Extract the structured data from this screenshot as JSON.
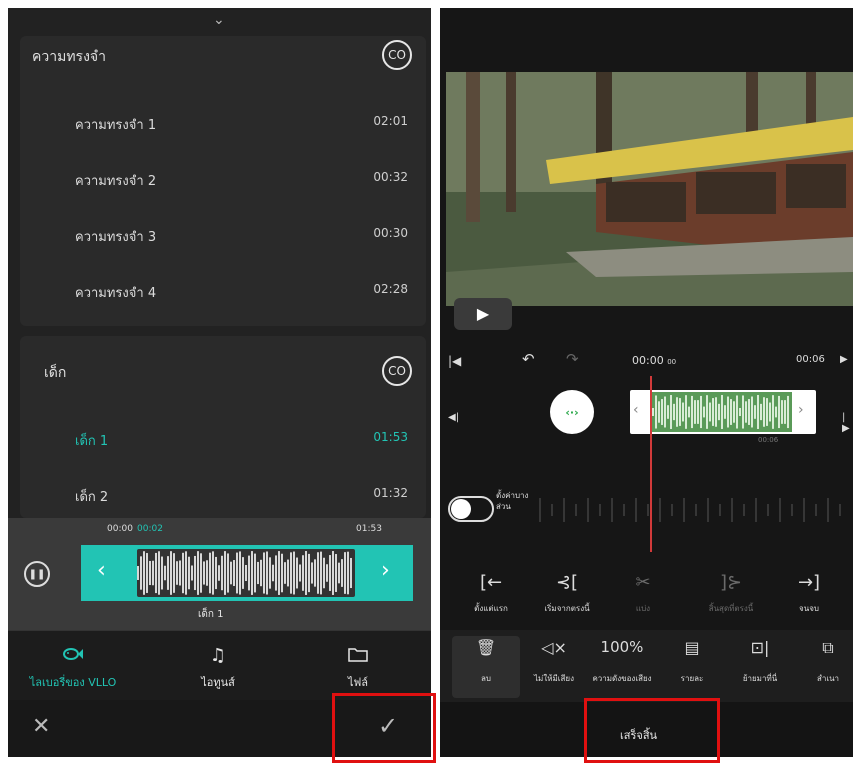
{
  "left": {
    "groups": [
      {
        "title": "ความทรงจำ",
        "badge": "CO",
        "tracks": [
          {
            "name": "ความทรงจำ 1",
            "duration": "02:01"
          },
          {
            "name": "ความทรงจำ 2",
            "duration": "00:32"
          },
          {
            "name": "ความทรงจำ 3",
            "duration": "00:30"
          },
          {
            "name": "ความทรงจำ 4",
            "duration": "02:28"
          }
        ]
      },
      {
        "title": "เด็ก",
        "badge": "CO",
        "tracks": [
          {
            "name": "เด็ก 1",
            "duration": "01:53",
            "selected": true
          },
          {
            "name": "เด็ก 2",
            "duration": "01:32"
          }
        ]
      }
    ],
    "player": {
      "time_start": "00:00",
      "time_current": "00:02",
      "time_end": "01:53",
      "track_name": "เด็ก 1"
    },
    "nav": [
      {
        "label": "ไลเบอรี่ของ VLLO",
        "icon": "fish-icon",
        "active": true
      },
      {
        "label": "ไอทูนส์",
        "icon": "music-note-icon",
        "active": false
      },
      {
        "label": "ไฟล์",
        "icon": "folder-icon",
        "active": false
      }
    ],
    "actions": {
      "cancel_glyph": "✕",
      "confirm_glyph": "✓"
    }
  },
  "right": {
    "timecode_current": "00:00",
    "timecode_frames": "00",
    "timecode_end": "00:06",
    "clip_time": "00:06",
    "toggle_label": "ตั้งค่าบางส่วน",
    "timeline_tools": [
      {
        "label": "ตั้งแต่แรก",
        "icon": "trim-start-icon",
        "dim": false
      },
      {
        "label": "เริ่มจากตรงนี้",
        "icon": "cut-here-icon",
        "dim": false
      },
      {
        "label": "แบ่ง",
        "icon": "split-icon",
        "dim": true
      },
      {
        "label": "สิ้นสุดที่ตรงนี้",
        "icon": "end-here-icon",
        "dim": true
      },
      {
        "label": "จนจบ",
        "icon": "trim-end-icon",
        "dim": false
      }
    ],
    "toolbar": [
      {
        "label": "ลบ",
        "icon": "trash-icon"
      },
      {
        "label": "ไม่ให้มีเสียง",
        "icon": "mute-icon"
      },
      {
        "label": "ความดังของเสียง",
        "value": "100%"
      },
      {
        "label": "รายละ",
        "icon": "details-icon"
      },
      {
        "label": "ย้ายมาที่นี่",
        "icon": "move-here-icon"
      },
      {
        "label": "สำเนา",
        "icon": "duplicate-icon"
      }
    ],
    "done_label": "เสร็จสิ้น"
  },
  "colors": {
    "accent": "#22c4b4",
    "highlight": "#e01010"
  }
}
